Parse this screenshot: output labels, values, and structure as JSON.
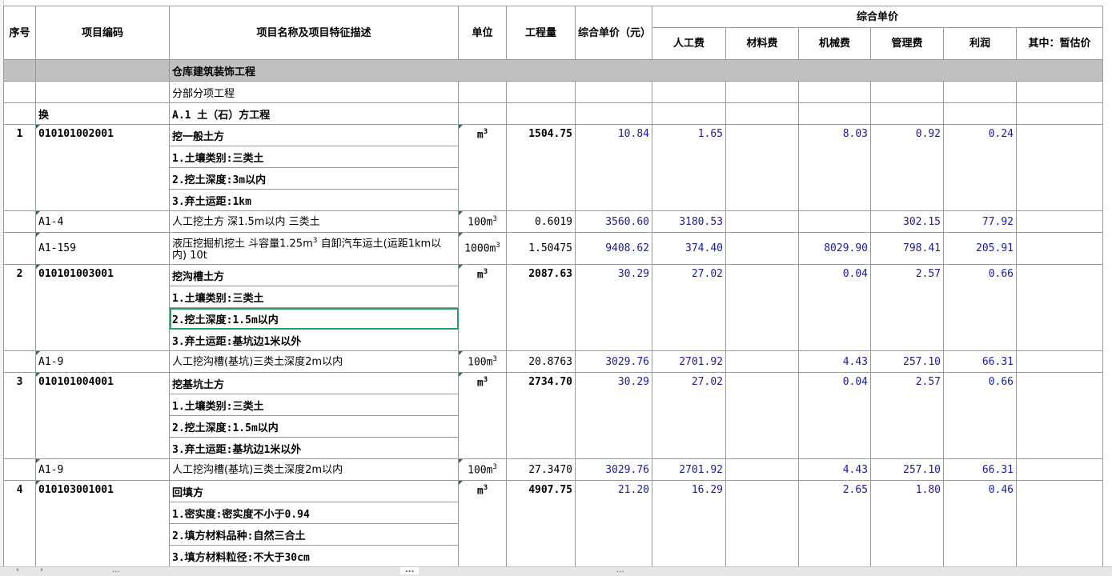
{
  "headers": {
    "seq": "序号",
    "code": "项目编码",
    "name": "项目名称及项目特征描述",
    "unit": "单位",
    "qty": "工程量",
    "unit_price": "综合单价（元）",
    "group": "综合单价",
    "labor": "人工费",
    "material": "材料费",
    "machine": "机械费",
    "mgmt": "管理费",
    "profit": "利润",
    "est": "其中：暂估价"
  },
  "section_title": "仓库建筑装饰工程",
  "subsection": "分部分项工程",
  "chapter": {
    "mark": "换",
    "name": "A.1 土（石）方工程"
  },
  "rows": [
    {
      "seq": "1",
      "code": "010101002001",
      "name": "挖一般土方",
      "unit": "m³",
      "qty": "1504.75",
      "price": "10.84",
      "labor": "1.65",
      "machine": "8.03",
      "mgmt": "0.92",
      "profit": "0.24",
      "features": [
        "1.土壤类别:三类土",
        "2.挖土深度:3m以内",
        "3.弃土运距:1km"
      ]
    },
    {
      "code": "A1-4",
      "name": "人工挖土方 深1.5m以内 三类土",
      "unit": "100m³",
      "qty": "0.6019",
      "price": "3560.60",
      "labor": "3180.53",
      "mgmt": "302.15",
      "profit": "77.92"
    },
    {
      "code": "A1-159",
      "name": "液压挖掘机挖土 斗容量1.25m³ 自卸汽车运土(运距1km以内) 10t",
      "unit": "1000m³",
      "qty": "1.50475",
      "price": "9408.62",
      "labor": "374.40",
      "machine": "8029.90",
      "mgmt": "798.41",
      "profit": "205.91"
    },
    {
      "seq": "2",
      "code": "010101003001",
      "name": "挖沟槽土方",
      "unit": "m³",
      "qty": "2087.63",
      "price": "30.29",
      "labor": "27.02",
      "machine": "0.04",
      "mgmt": "2.57",
      "profit": "0.66",
      "features": [
        "1.土壤类别:三类土",
        "2.挖土深度:1.5m以内",
        "3.弃土运距:基坑边1米以外"
      ]
    },
    {
      "code": "A1-9",
      "name": "人工挖沟槽(基坑)三类土深度2m以内",
      "unit": "100m³",
      "qty": "20.8763",
      "price": "3029.76",
      "labor": "2701.92",
      "machine": "4.43",
      "mgmt": "257.10",
      "profit": "66.31"
    },
    {
      "seq": "3",
      "code": "010101004001",
      "name": "挖基坑土方",
      "unit": "m³",
      "qty": "2734.70",
      "price": "30.29",
      "labor": "27.02",
      "machine": "0.04",
      "mgmt": "2.57",
      "profit": "0.66",
      "features": [
        "1.土壤类别:三类土",
        "2.挖土深度:1.5m以内",
        "3.弃土运距:基坑边1米以外"
      ]
    },
    {
      "code": "A1-9",
      "name": "人工挖沟槽(基坑)三类土深度2m以内",
      "unit": "100m³",
      "qty": "27.3470",
      "price": "3029.76",
      "labor": "2701.92",
      "machine": "4.43",
      "mgmt": "257.10",
      "profit": "66.31"
    },
    {
      "seq": "4",
      "code": "010103001001",
      "name": "回填方",
      "unit": "m³",
      "qty": "4907.75",
      "price": "21.20",
      "labor": "16.29",
      "machine": "2.65",
      "mgmt": "1.80",
      "profit": "0.46",
      "features": [
        "1.密实度:密实度不小于0.94",
        "2.填方材料品种:自然三合土",
        "3.填方材料粒径:不大于30cm"
      ]
    }
  ],
  "sheet_tabs": [
    "...",
    "...",
    "..."
  ]
}
